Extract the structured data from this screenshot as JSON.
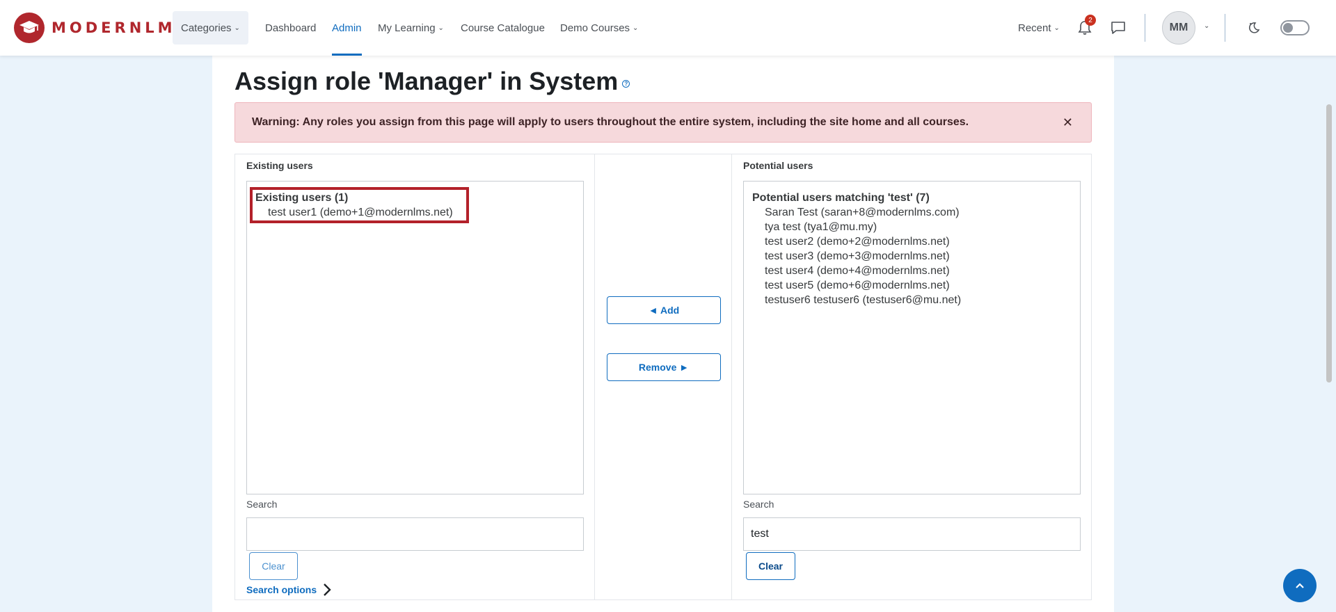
{
  "brand": {
    "name": "MODERNLMS",
    "color": "#b0272d"
  },
  "nav": {
    "categories": "Categories",
    "dashboard": "Dashboard",
    "admin": "Admin",
    "my_learning": "My Learning",
    "course_catalogue": "Course Catalogue",
    "demo_courses": "Demo Courses",
    "recent": "Recent",
    "notification_count": "2",
    "avatar_initials": "MM"
  },
  "page": {
    "title": "Assign role 'Manager' in System",
    "warning": "Warning: Any roles you assign from this page will apply to users throughout the entire system, including the site home and all courses."
  },
  "existing": {
    "label": "Existing users",
    "group_title": "Existing users (1)",
    "options": [
      "test user1 (demo+1@modernlms.net)"
    ],
    "search_label": "Search",
    "search_value": "",
    "clear_label": "Clear",
    "search_options_label": "Search options"
  },
  "actions": {
    "add_label": "◄ Add",
    "remove_label": "Remove ►"
  },
  "potential": {
    "label": "Potential users",
    "group_title": "Potential users matching 'test' (7)",
    "options": [
      "Saran Test (saran+8@modernlms.com)",
      "tya test (tya1@mu.my)",
      "test user2 (demo+2@modernlms.net)",
      "test user3 (demo+3@modernlms.net)",
      "test user4 (demo+4@modernlms.net)",
      "test user5 (demo+6@modernlms.net)",
      "testuser6 testuser6 (testuser6@mu.net)"
    ],
    "search_label": "Search",
    "search_value": "test",
    "clear_label": "Clear"
  },
  "colors": {
    "primary": "#0f6cbf",
    "alert_bg": "#f6d9dc",
    "highlight": "#b3212a",
    "page_bg": "#eaf3fb"
  }
}
